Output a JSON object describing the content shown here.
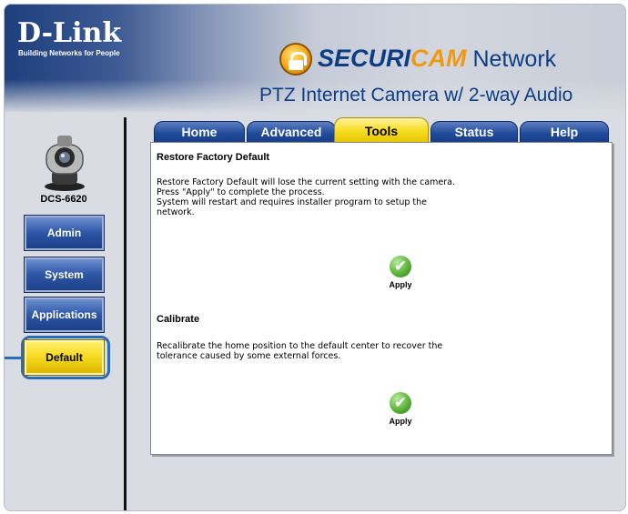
{
  "header": {
    "brand": "D-Link",
    "tagline": "Building Networks for People",
    "product_part1": "SECURI",
    "product_part2": "CAM",
    "product_part3": " Network",
    "subtitle": "PTZ Internet Camera w/ 2-way Audio"
  },
  "sidebar": {
    "model": "DCS-6620",
    "items": [
      {
        "label": "Admin",
        "active": false
      },
      {
        "label": "System",
        "active": false
      },
      {
        "label": "Applications",
        "active": false
      },
      {
        "label": "Default",
        "active": true
      }
    ]
  },
  "tabs": [
    {
      "label": "Home",
      "active": false
    },
    {
      "label": "Advanced",
      "active": false
    },
    {
      "label": "Tools",
      "active": true
    },
    {
      "label": "Status",
      "active": false
    },
    {
      "label": "Help",
      "active": false
    }
  ],
  "sections": {
    "restore": {
      "title": "Restore Factory Default",
      "desc": [
        "Restore Factory Default will lose the current setting with the camera.",
        "Press \"Apply\" to complete the process.",
        "System will restart and requires installer program to setup the",
        "network."
      ],
      "apply_label": "Apply"
    },
    "calibrate": {
      "title": "Calibrate",
      "desc": [
        "Recalibrate the home position to the default center to recover the",
        "tolerance caused by some external forces."
      ],
      "apply_label": "Apply"
    }
  },
  "colors": {
    "tab_blue": "#1f4a9a",
    "active_yellow": "#f7de22",
    "brand_navy": "#0c3d85",
    "highlight": "#2b6cb8"
  },
  "icons": {
    "logo": "lock-icon",
    "camera": "camera-icon",
    "apply": "checkmark-icon"
  }
}
